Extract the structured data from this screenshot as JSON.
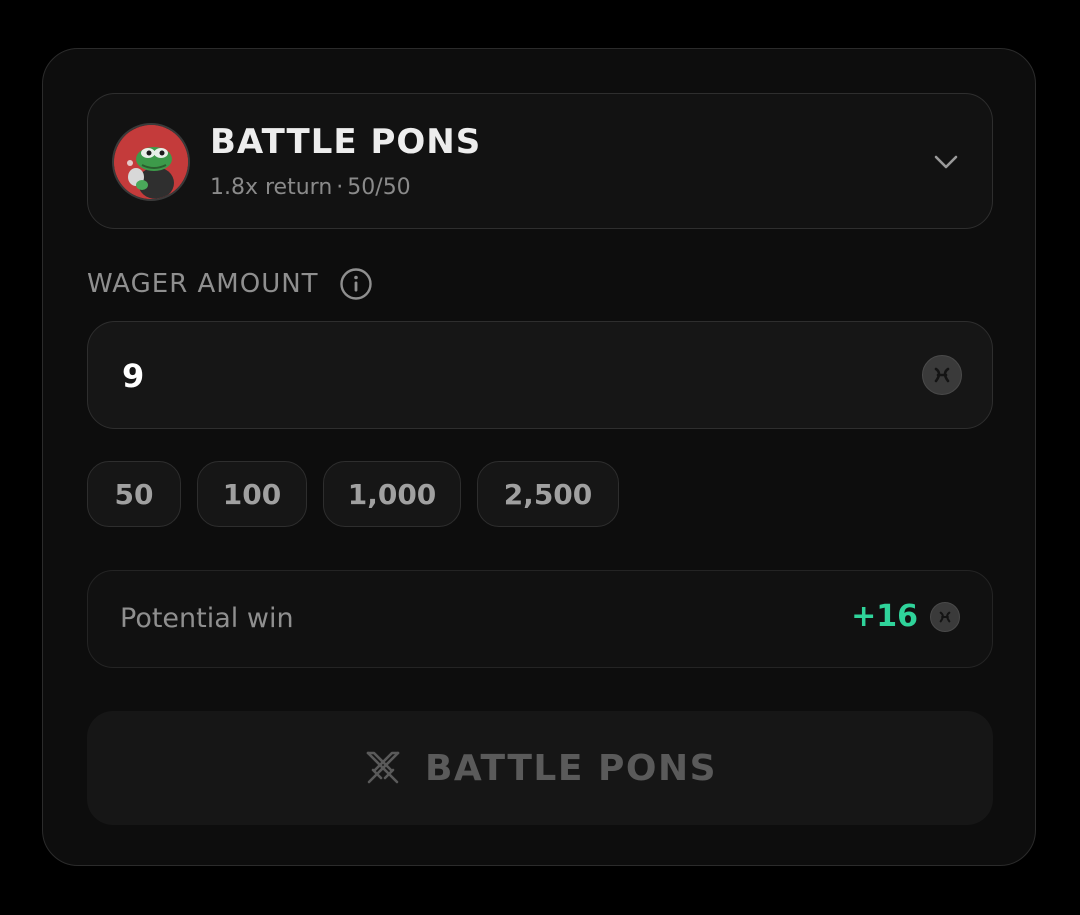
{
  "game": {
    "title": "BATTLE PONS",
    "return_text": "1.8x return",
    "separator": "·",
    "odds_text": "50/50",
    "avatar_icon": "frog-avatar",
    "dropdown_icon": "chevron-down-icon"
  },
  "wager": {
    "label": "WAGER AMOUNT",
    "info_icon": "info-icon",
    "value": "9",
    "currency_icon": "coin-icon"
  },
  "presets": [
    "50",
    "100",
    "1,000",
    "2,500"
  ],
  "potential_win": {
    "label": "Potential win",
    "value": "+16",
    "currency_icon": "coin-icon"
  },
  "action": {
    "label": "BATTLE PONS",
    "icon": "crossed-swords-icon"
  },
  "colors": {
    "background": "#000000",
    "panel": "#0d0d0d",
    "win_green": "#2fd39a",
    "muted_text": "#8f8f8f"
  }
}
